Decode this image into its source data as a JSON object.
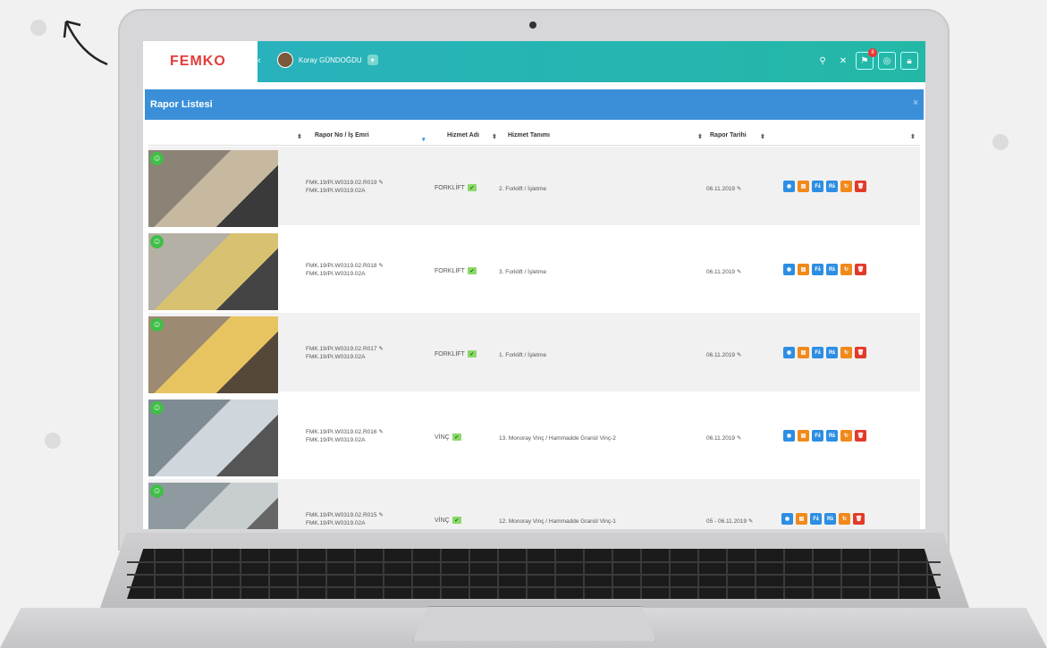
{
  "app": {
    "brand": "FEMKO",
    "user_name": "Koray GÜNDOĞDU",
    "notification_count": "8"
  },
  "panel": {
    "title": "Rapor Listesi",
    "close": "×"
  },
  "table": {
    "columns": [
      "Rapor No / İş Emri",
      "Hizmet Adı",
      "Hizmet Tanımı",
      "Rapor Tarihi"
    ],
    "rows": [
      {
        "rapor_no": "FMK.19/PI.W0319.02.R019",
        "is_emri": "FMK.19/PI.W0319.02A",
        "hizmet": "FORKLİFT",
        "tanim": "2. Forklift / İşletme",
        "tarih": "06.11.2019"
      },
      {
        "rapor_no": "FMK.19/PI.W0319.02.R018",
        "is_emri": "FMK.19/PI.W0319.02A",
        "hizmet": "FORKLİFT",
        "tanim": "3. Forklift / İşletme",
        "tarih": "06.11.2019"
      },
      {
        "rapor_no": "FMK.19/PI.W0319.02.R017",
        "is_emri": "FMK.19/PI.W0319.02A",
        "hizmet": "FORKLİFT",
        "tanim": "1. Forklift / İşletme",
        "tarih": "06.11.2019"
      },
      {
        "rapor_no": "FMK.19/PI.W0319.02.R016",
        "is_emri": "FMK.19/PI.W0319.02A",
        "hizmet": "VİNÇ",
        "tanim": "13. Monoray Vinç / Hammadde Granül Vinç-2",
        "tarih": "06.11.2019"
      },
      {
        "rapor_no": "FMK.19/PI.W0319.02.R015",
        "is_emri": "FMK.19/PI.W0319.02A",
        "hizmet": "VİNÇ",
        "tanim": "12. Monoray Vinç / Hammadde Granül Vinç-1",
        "tarih": "05 - 06.11.2019"
      }
    ]
  },
  "actions": [
    "F",
    "R"
  ],
  "icons": {
    "search": "search-icon",
    "close": "close-icon",
    "cart": "cart-icon",
    "globe": "globe-icon",
    "lock": "lock-icon",
    "edit": "pencil-icon",
    "eye": "eye-icon",
    "refresh": "refresh-icon",
    "delete": "trash-icon"
  },
  "colors": {
    "header": "#23b8a6",
    "panel": "#3a8fd8",
    "blue": "#2d8ee3",
    "orange": "#f08a1c",
    "red": "#e23a2a",
    "success": "#3fbf47"
  }
}
